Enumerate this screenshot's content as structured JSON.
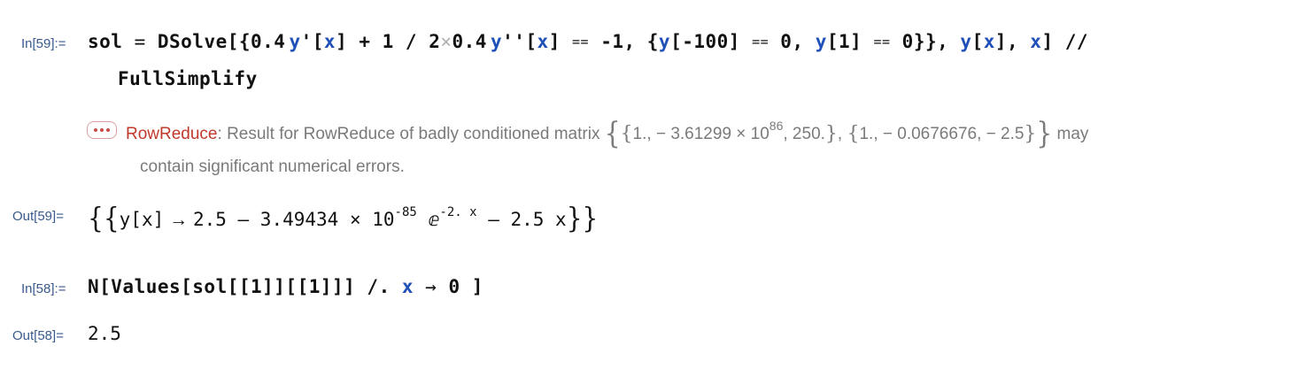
{
  "cells": {
    "in59": {
      "label": "In[59]:=",
      "line1": {
        "sol": "sol",
        "eq": " = ",
        "dsolve": "DSolve[{0.4",
        "y1": "y",
        "prime1": "'[",
        "x1": "x",
        "part1": "] + 1 / 2",
        "times": "×",
        "part2": "0.4",
        "y2": "y",
        "prime2": "''[",
        "x2": "x",
        "part3": "] ",
        "eqeq1": "==",
        "part4": " -1, {",
        "y3": "y",
        "part5": "[-100] ",
        "eqeq2": "==",
        "part6": " 0, ",
        "y4": "y",
        "part7": "[1] ",
        "eqeq3": "==",
        "part8": " 0}}, ",
        "y5": "y",
        "part9": "[",
        "x3": "x",
        "part10": "], ",
        "x4": "x",
        "part11": "] //"
      },
      "line2": "FullSimplify"
    },
    "message": {
      "name": "RowReduce",
      "sep": ": ",
      "text1": "Result for RowReduce of badly conditioned matrix ",
      "m1a": "1., − 3.61299 × 10",
      "m1exp": "86",
      "m1b": ", 250.",
      "m2": "1., − 0.0676676, − 2.5",
      "text2": " may",
      "text3": "contain significant numerical errors."
    },
    "out59": {
      "label": "Out[59]=",
      "open": "{{",
      "y": "y",
      "lb": "[",
      "x": "x",
      "rb": "]",
      "arrow": " → ",
      "a": "2.5 – 3.49434 × 10",
      "exp1": "-85",
      "e": " ⅇ",
      "exp2": "-2. x",
      "b": " – 2.5 x",
      "close": "}}"
    },
    "in58": {
      "label": "In[58]:=",
      "code1": "N[Values[sol[[1]][[1]]] /. ",
      "x": "x",
      "arrow": " → ",
      "code2": "0 ]"
    },
    "out58": {
      "label": "Out[58]=",
      "value": "2.5"
    }
  },
  "colors": {
    "label": "#3a5a8c",
    "variable": "#1f4fb8",
    "message_name": "#c0392b",
    "message_text": "#7a7a7a"
  },
  "icons": {
    "message_menu": "ellipsis-icon"
  }
}
